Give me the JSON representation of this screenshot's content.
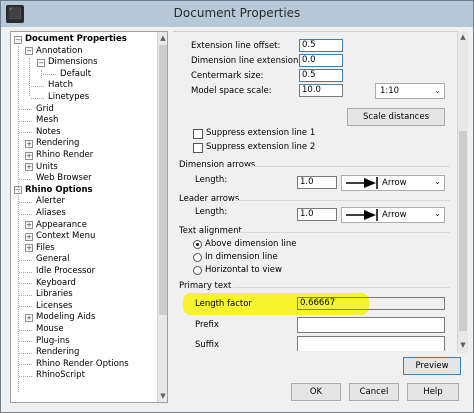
{
  "window": {
    "title": "Document Properties"
  },
  "tree": {
    "items": [
      {
        "label": "Document Properties",
        "bold": true,
        "level": 0,
        "expander": "−"
      },
      {
        "label": "Annotation",
        "level": 1,
        "expander": "−"
      },
      {
        "label": "Dimensions",
        "level": 2,
        "expander": "−"
      },
      {
        "label": "Default",
        "level": 3,
        "expander": ""
      },
      {
        "label": "Hatch",
        "level": 2,
        "expander": ""
      },
      {
        "label": "Linetypes",
        "level": 2,
        "expander": ""
      },
      {
        "label": "Grid",
        "level": 1,
        "expander": ""
      },
      {
        "label": "Mesh",
        "level": 1,
        "expander": ""
      },
      {
        "label": "Notes",
        "level": 1,
        "expander": ""
      },
      {
        "label": "Rendering",
        "level": 1,
        "expander": "+"
      },
      {
        "label": "Rhino Render",
        "level": 1,
        "expander": "+"
      },
      {
        "label": "Units",
        "level": 1,
        "expander": "+"
      },
      {
        "label": "Web Browser",
        "level": 1,
        "expander": ""
      },
      {
        "label": "Rhino Options",
        "bold": true,
        "level": 0,
        "expander": "−"
      },
      {
        "label": "Alerter",
        "level": 1,
        "expander": ""
      },
      {
        "label": "Aliases",
        "level": 1,
        "expander": ""
      },
      {
        "label": "Appearance",
        "level": 1,
        "expander": "+"
      },
      {
        "label": "Context Menu",
        "level": 1,
        "expander": "+"
      },
      {
        "label": "Files",
        "level": 1,
        "expander": "+"
      },
      {
        "label": "General",
        "level": 1,
        "expander": ""
      },
      {
        "label": "Idle Processor",
        "level": 1,
        "expander": ""
      },
      {
        "label": "Keyboard",
        "level": 1,
        "expander": ""
      },
      {
        "label": "Libraries",
        "level": 1,
        "expander": ""
      },
      {
        "label": "Licenses",
        "level": 1,
        "expander": ""
      },
      {
        "label": "Modeling Aids",
        "level": 1,
        "expander": "+"
      },
      {
        "label": "Mouse",
        "level": 1,
        "expander": ""
      },
      {
        "label": "Plug-ins",
        "level": 1,
        "expander": ""
      },
      {
        "label": "Rendering",
        "level": 1,
        "expander": ""
      },
      {
        "label": "Rhino Render Options",
        "level": 1,
        "expander": ""
      },
      {
        "label": "RhinoScript",
        "level": 1,
        "expander": ""
      }
    ]
  },
  "panel": {
    "extension_line_offset": {
      "label": "Extension line offset:",
      "value": "0.5"
    },
    "dimension_line_extension": {
      "label": "Dimension line extension:",
      "value": "0.0"
    },
    "centermark_size": {
      "label": "Centermark size:",
      "value": "0.5"
    },
    "model_space_scale": {
      "label": "Model space scale:",
      "value": "10.0",
      "ratio": "1:10"
    },
    "scale_distances_label": "Scale distances",
    "suppress_ext_1": "Suppress extension line 1",
    "suppress_ext_2": "Suppress extension line 2",
    "dimension_arrows": {
      "title": "Dimension arrows",
      "length_label": "Length:",
      "length_value": "1.0",
      "style": "Arrow"
    },
    "leader_arrows": {
      "title": "Leader arrows",
      "length_label": "Length:",
      "length_value": "1.0",
      "style": "Arrow"
    },
    "text_alignment": {
      "title": "Text alignment",
      "options": [
        "Above dimension line",
        "In dimension line",
        "Horizontal to view"
      ],
      "selected": "Above dimension line"
    },
    "primary_text": {
      "title": "Primary text",
      "length_factor_label": "Length factor",
      "length_factor_value": "0.66667",
      "prefix_label": "Prefix",
      "prefix_value": "",
      "suffix_label": "Suffix",
      "suffix_value": ""
    },
    "highlight_color": "#f7f322"
  },
  "buttons": {
    "preview": "Preview",
    "ok": "OK",
    "cancel": "Cancel",
    "help": "Help"
  }
}
